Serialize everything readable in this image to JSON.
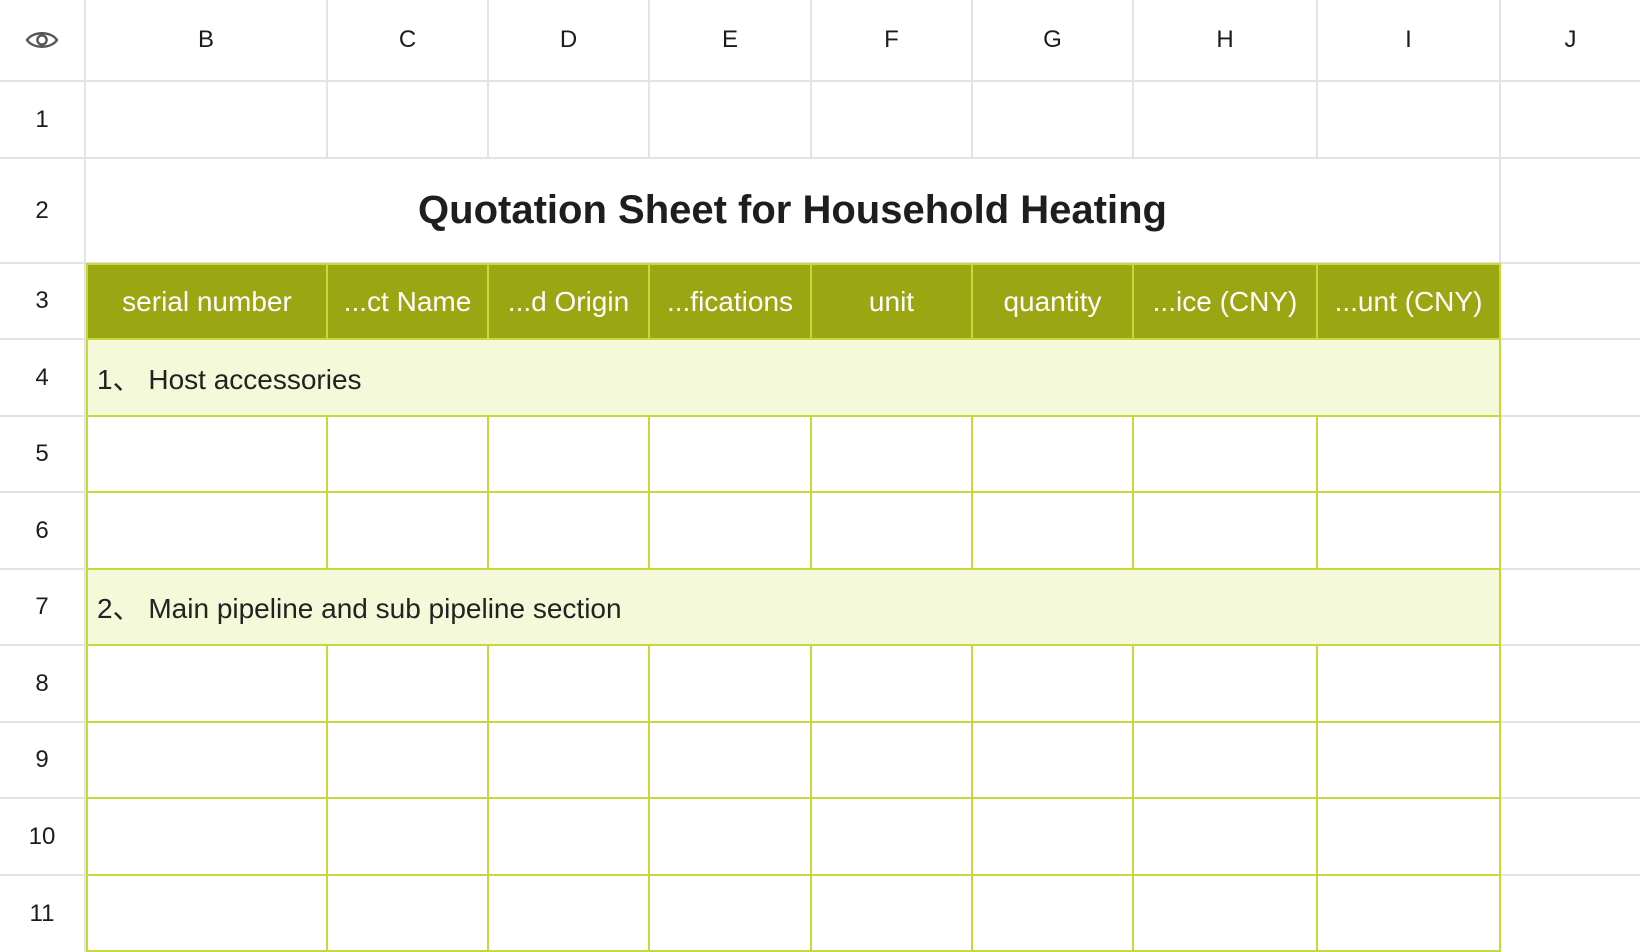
{
  "columns": [
    "B",
    "C",
    "D",
    "E",
    "F",
    "G",
    "H",
    "I",
    "J"
  ],
  "rows": [
    "1",
    "2",
    "3",
    "4",
    "5",
    "6",
    "7",
    "8",
    "9",
    "10",
    "11"
  ],
  "title": "Quotation Sheet for Household Heating",
  "headers": [
    "serial number",
    "...ct Name",
    "...d Origin",
    "...fications",
    "unit",
    "quantity",
    "...ice (CNY)",
    "...unt (CNY)"
  ],
  "sections": {
    "host_accessories": "1、 Host accessories",
    "main_pipeline": "2、 Main pipeline and sub pipeline section"
  },
  "colors": {
    "header_fill": "#9aa612",
    "section_fill": "#f4f9da",
    "table_border": "#c7d93a",
    "grid_line": "#e3e3e3"
  },
  "icons": {
    "visibility": "eye-icon"
  }
}
